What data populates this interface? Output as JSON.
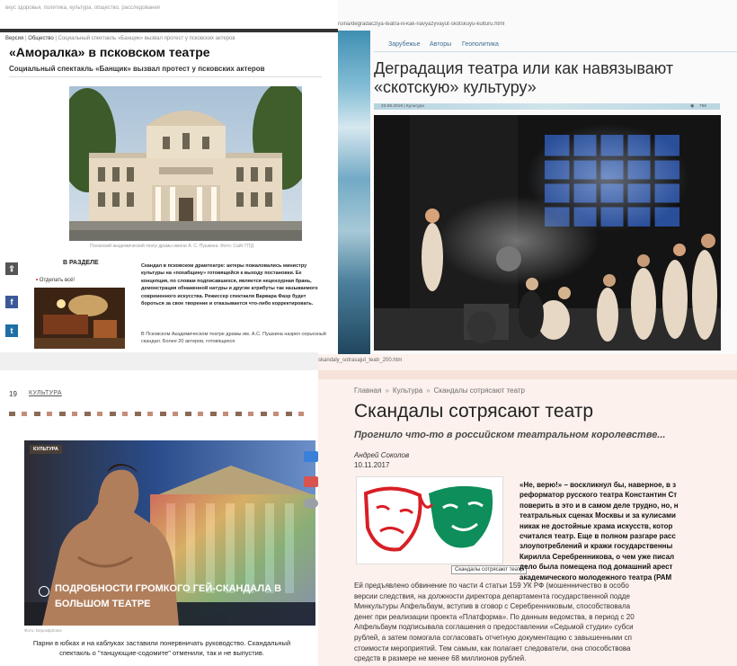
{
  "panel1": {
    "topbar": "вкус здоровья, политика, культура, общество, расследования",
    "breadcrumb": [
      "Версия",
      "Общество",
      "Социальный спектакль «Банщик» вызвал протест у псковских актеров"
    ],
    "title": "«Аморалка» в псковском театре",
    "lead": "Социальный спектакль «Банщик» вызвал протест у псковских актеров",
    "photo_caption": "Псковский академический театр драмы имени А. С. Пушкина. Фото: Сайт ПТД",
    "share_icons": [
      "share-icon",
      "facebook-icon",
      "twitter-icon"
    ],
    "section_title": "В РАЗДЕЛЕ",
    "section_link_prefix": "•",
    "section_link": "Отделать всё!",
    "article_text": "Скандал в псковском драмтеатре: актеры пожаловались министру культуры на «похабщину» готовящейся к выходу постановки. Ее концепция, по словам подписавшихся, является нецензурная брань, демонстрация обнаженной натуры и другие атрибуты так называемого современного искусства. Режиссер спектакля Варвара Фаэр будет бороться за свое творение и отказывается что-либо корректировать.",
    "article_text2": "В Псковском Академическом театре драмы им. А.С. Пушкина назрел серьезный скандал. Более 20 актеров, готовящихся"
  },
  "panel2": {
    "url": "ruina/degradacziya-teatra-ili-kak-navyazyvayut-skotskuyu-kulturu.html",
    "menu": [
      "Зарубежье",
      "Авторы",
      "Геополитика"
    ],
    "title": "Деградация театра или как навязывают «скотскую» культуру»",
    "date": "23.08.2018 | Культура",
    "views": "756"
  },
  "panel3": {
    "page_num": "19",
    "category": "КУЛЬТУРА",
    "badge": "КУЛЬТУРА",
    "promo_title": "ПОДРОБНОСТИ ГРОМКОГО ГЕЙ-СКАНДАЛА В БОЛЬШОМ ТЕАТРЕ",
    "photo_credit": "Фото: Depositphotos",
    "description": "Парни в юбках и на каблуках заставили понервничать руководство. Скандальный спектакль о \"танцующие-содомите\" отменили, так и не выпустив."
  },
  "panel4": {
    "url": "skandaly_sotrasajut_teatr_200.htm",
    "breadcrumb": [
      "Главная",
      "Культура",
      "Скандалы сотрясают театр"
    ],
    "title": "Скандалы сотрясают театр",
    "subtitle": "Прогнило что-то в российском театральном королевстве...",
    "author": "Андрей Соколов",
    "date": "10.11.2017",
    "image_tooltip": "Скандалы сотрясают театр",
    "quote_lines": [
      "«Не, верю!» – воскликнул бы, наверное, в з",
      "реформатор русского театра Константин Ст",
      "поверить в это и в самом деле трудно, но, н",
      "театральных сценах Москвы и за кулисами",
      "никак не достойные храма искусств, котор",
      "считался театр. Еще в полном разгаре расс",
      "злоупотреблений и кражи государственны",
      "Кирилла Серебренникова, о чем уже писал",
      "дело была помещена под домашний арест",
      "академического молодежного театра (РАМ"
    ],
    "body_lines": [
      "Ей предъявлено обвинение по части 4 статьи 159 УК РФ (мошенничество в особо",
      "версии следствия, на должности директора департамента государственной подде",
      "Минкультуры Апфельбаум, вступив в сговор с Серебренниковым, способствовала",
      "денег при реализации проекта «Платформа». По данным ведомства, в период с 20",
      "Апфельбаум подписывала соглашения о предоставлении «Седьмой студии» субси",
      "рублей, а затем помогала согласовать отчетную документацию с завышенными сп",
      "стоимости мероприятий. Тем самым, как полагает следователи, она способствова",
      "средств в размере не менее 68 миллионов рублей."
    ]
  }
}
